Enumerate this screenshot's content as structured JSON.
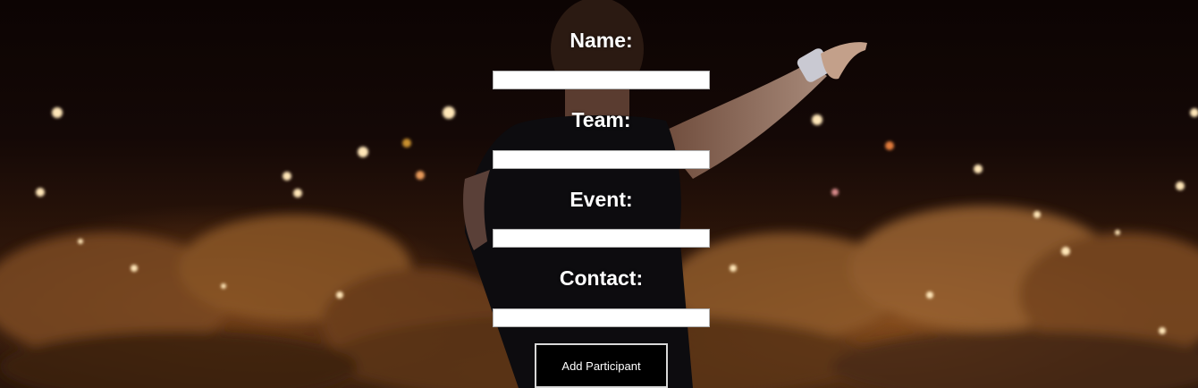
{
  "form": {
    "name_label": "Name:",
    "team_label": "Team:",
    "event_label": "Event:",
    "contact_label": "Contact:",
    "name_value": "",
    "team_value": "",
    "event_value": "",
    "contact_value": "",
    "submit_label": "Add Participant"
  },
  "background": {
    "image": "concert-stage-photo"
  }
}
